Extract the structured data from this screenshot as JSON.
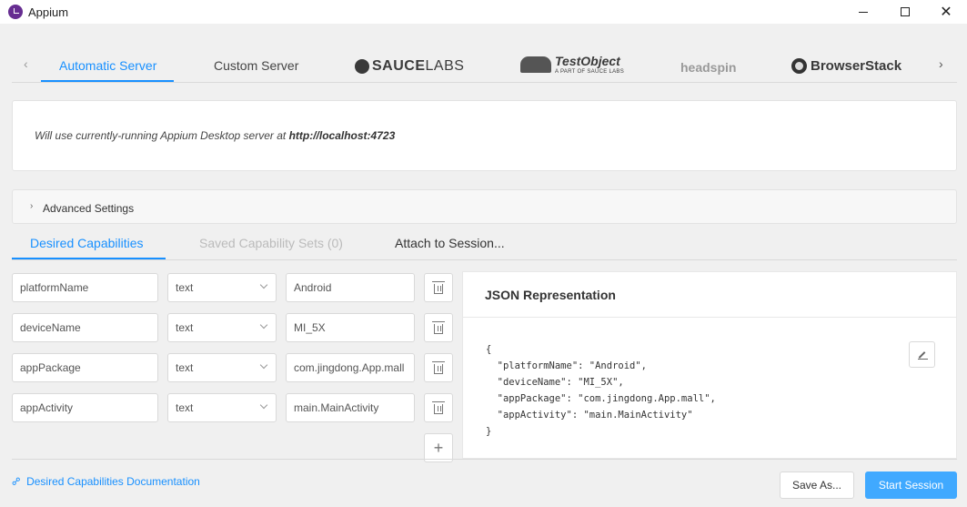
{
  "window": {
    "title": "Appium",
    "minimize_glyph": "",
    "close_glyph": "✕"
  },
  "provider_tabs": {
    "left_arrow": "‹",
    "right_arrow": "›",
    "automatic": "Automatic Server",
    "custom": "Custom Server",
    "saucelabs_bold": "SAUCE",
    "saucelabs_light": "LABS",
    "testobject": "TestObject",
    "testobject_sub": "A PART OF SAUCE LABS",
    "headspin": "headspin",
    "browserstack": "BrowserStack"
  },
  "server": {
    "message_prefix": "Will use currently-running Appium Desktop server at ",
    "url": "http://localhost:4723"
  },
  "advanced": {
    "chevron": "›",
    "label": "Advanced Settings"
  },
  "cap_tabs": {
    "desired": "Desired Capabilities",
    "saved": "Saved Capability Sets (0)",
    "attach": "Attach to Session..."
  },
  "capabilities": [
    {
      "name": "platformName",
      "type": "text",
      "value": "Android"
    },
    {
      "name": "deviceName",
      "type": "text",
      "value": "MI_5X"
    },
    {
      "name": "appPackage",
      "type": "text",
      "value": "com.jingdong.App.mall"
    },
    {
      "name": "appActivity",
      "type": "text",
      "value": "main.MainActivity"
    }
  ],
  "add_glyph": "+",
  "json_panel": {
    "title": "JSON Representation",
    "content": "{\n  \"platformName\": \"Android\",\n  \"deviceName\": \"MI_5X\",\n  \"appPackage\": \"com.jingdong.App.mall\",\n  \"appActivity\": \"main.MainActivity\"\n}"
  },
  "footer": {
    "link_glyph": "⚯",
    "docs_link": "Desired Capabilities Documentation",
    "save_as": "Save As...",
    "start_session": "Start Session"
  },
  "colors": {
    "accent": "#1890ff",
    "primary_button": "#40a9ff",
    "app_icon": "#662d91"
  }
}
